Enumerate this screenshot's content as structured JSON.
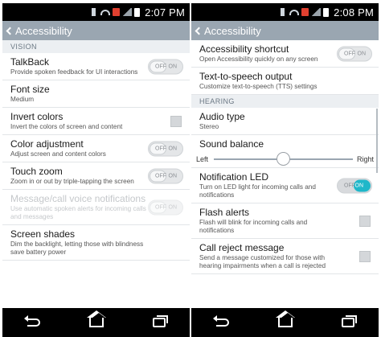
{
  "left": {
    "status_time": "2:07 PM",
    "title": "Accessibility",
    "section": "VISION",
    "items": [
      {
        "title": "TalkBack",
        "sub": "Provide spoken feedback for UI interactions"
      },
      {
        "title": "Font size",
        "sub": "Medium"
      },
      {
        "title": "Invert colors",
        "sub": "Invert the colors of screen and content"
      },
      {
        "title": "Color adjustment",
        "sub": "Adjust screen and content colors"
      },
      {
        "title": "Touch zoom",
        "sub": "Zoom in or out by triple-tapping the screen"
      },
      {
        "title": "Message/call voice notifications",
        "sub": "Use automatic spoken alerts for incoming calls and messages"
      },
      {
        "title": "Screen shades",
        "sub": "Dim the backlight, letting those with blindness save battery power"
      }
    ]
  },
  "right": {
    "status_time": "2:08 PM",
    "title": "Accessibility",
    "section": "HEARING",
    "items": [
      {
        "title": "Accessibility shortcut",
        "sub": "Open Accessibility quickly on any screen"
      },
      {
        "title": "Text-to-speech output",
        "sub": "Customize text-to-speech (TTS) settings"
      },
      {
        "title": "Audio type",
        "sub": "Stereo"
      },
      {
        "title": "Sound balance"
      },
      {
        "title": "Notification LED",
        "sub": "Turn on LED light for incoming calls and notifications"
      },
      {
        "title": "Flash alerts",
        "sub": "Flash will blink for incoming calls and notifications"
      },
      {
        "title": "Call reject message",
        "sub": "Send a message customized for those with hearing impairments when a call is rejected"
      }
    ],
    "slider": {
      "left_label": "Left",
      "right_label": "Right",
      "value": 0.5
    }
  },
  "toggle": {
    "off": "OFF",
    "on": "ON"
  },
  "colors": {
    "appbar": "#9aa6b1",
    "accent": "#1fb7c9",
    "statusbar": "#000000"
  },
  "icons": [
    "mute-icon",
    "wifi-icon",
    "notification-icon",
    "signal-icon",
    "battery-icon",
    "back-icon",
    "nav-back-icon",
    "nav-home-icon",
    "nav-recent-icon"
  ]
}
